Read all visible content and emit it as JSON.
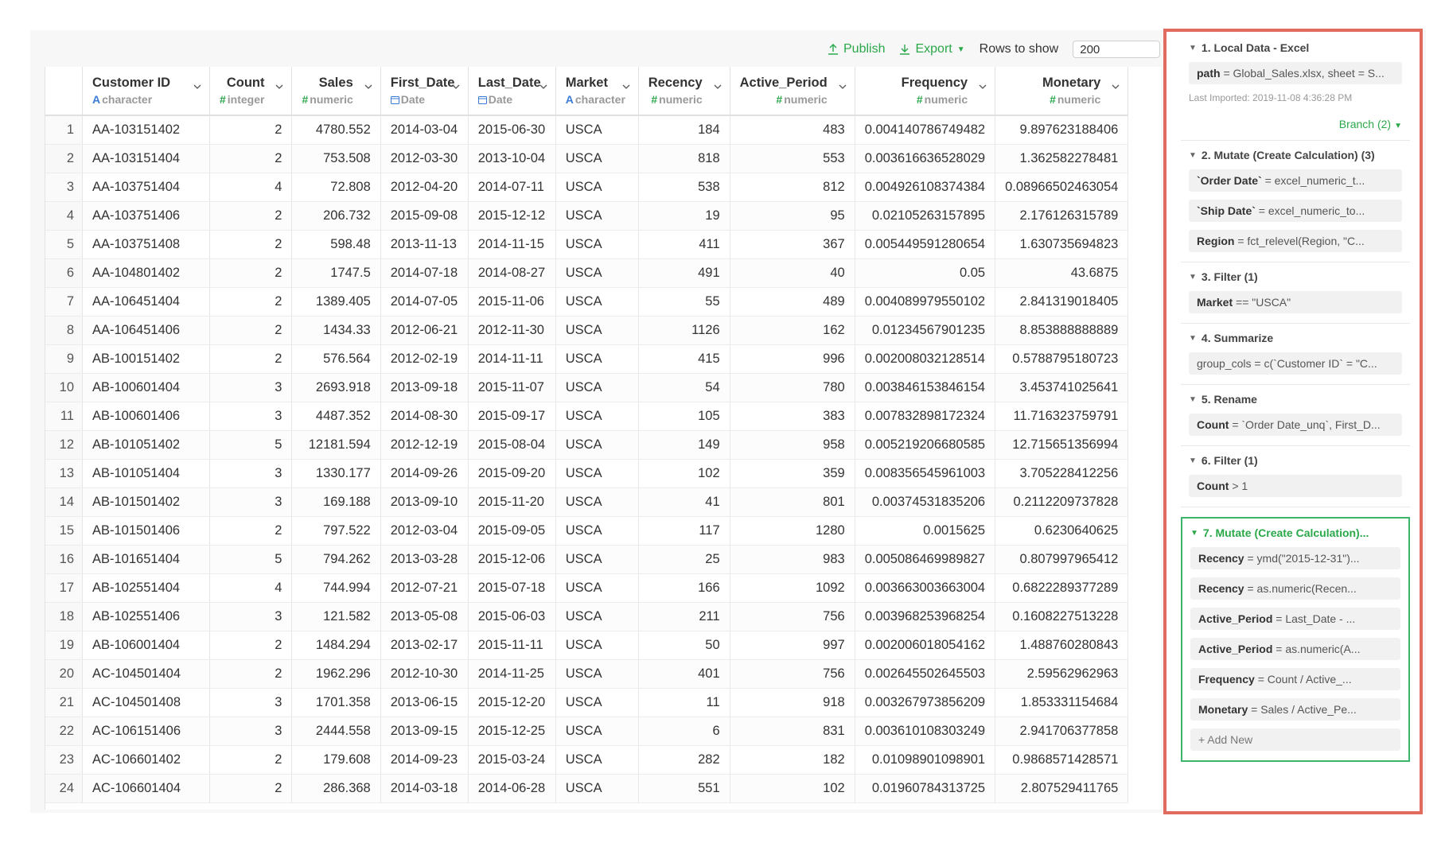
{
  "toolbar": {
    "publish_label": "Publish",
    "export_label": "Export",
    "rows_label": "Rows to show",
    "rows_value": "200"
  },
  "columns": [
    {
      "name": "",
      "type": "",
      "glyph": "",
      "align": "right"
    },
    {
      "name": "Customer ID",
      "type": "character",
      "glyph": "A",
      "align": "left"
    },
    {
      "name": "Count",
      "type": "integer",
      "glyph": "#",
      "align": "right"
    },
    {
      "name": "Sales",
      "type": "numeric",
      "glyph": "#",
      "align": "right"
    },
    {
      "name": "First_Date",
      "type": "Date",
      "glyph": "cal",
      "align": "left"
    },
    {
      "name": "Last_Date",
      "type": "Date",
      "glyph": "cal",
      "align": "left"
    },
    {
      "name": "Market",
      "type": "character",
      "glyph": "A",
      "align": "left"
    },
    {
      "name": "Recency",
      "type": "numeric",
      "glyph": "#",
      "align": "right"
    },
    {
      "name": "Active_Period",
      "type": "numeric",
      "glyph": "#",
      "align": "right"
    },
    {
      "name": "Frequency",
      "type": "numeric",
      "glyph": "#",
      "align": "right"
    },
    {
      "name": "Monetary",
      "type": "numeric",
      "glyph": "#",
      "align": "right"
    }
  ],
  "rows": [
    [
      "1",
      "AA-103151402",
      "2",
      "4780.552",
      "2014-03-04",
      "2015-06-30",
      "USCA",
      "184",
      "483",
      "0.004140786749482",
      "9.897623188406"
    ],
    [
      "2",
      "AA-103151404",
      "2",
      "753.508",
      "2012-03-30",
      "2013-10-04",
      "USCA",
      "818",
      "553",
      "0.003616636528029",
      "1.362582278481"
    ],
    [
      "3",
      "AA-103751404",
      "4",
      "72.808",
      "2012-04-20",
      "2014-07-11",
      "USCA",
      "538",
      "812",
      "0.004926108374384",
      "0.08966502463054"
    ],
    [
      "4",
      "AA-103751406",
      "2",
      "206.732",
      "2015-09-08",
      "2015-12-12",
      "USCA",
      "19",
      "95",
      "0.02105263157895",
      "2.176126315789"
    ],
    [
      "5",
      "AA-103751408",
      "2",
      "598.48",
      "2013-11-13",
      "2014-11-15",
      "USCA",
      "411",
      "367",
      "0.005449591280654",
      "1.630735694823"
    ],
    [
      "6",
      "AA-104801402",
      "2",
      "1747.5",
      "2014-07-18",
      "2014-08-27",
      "USCA",
      "491",
      "40",
      "0.05",
      "43.6875"
    ],
    [
      "7",
      "AA-106451404",
      "2",
      "1389.405",
      "2014-07-05",
      "2015-11-06",
      "USCA",
      "55",
      "489",
      "0.004089979550102",
      "2.841319018405"
    ],
    [
      "8",
      "AA-106451406",
      "2",
      "1434.33",
      "2012-06-21",
      "2012-11-30",
      "USCA",
      "1126",
      "162",
      "0.01234567901235",
      "8.853888888889"
    ],
    [
      "9",
      "AB-100151402",
      "2",
      "576.564",
      "2012-02-19",
      "2014-11-11",
      "USCA",
      "415",
      "996",
      "0.002008032128514",
      "0.5788795180723"
    ],
    [
      "10",
      "AB-100601404",
      "3",
      "2693.918",
      "2013-09-18",
      "2015-11-07",
      "USCA",
      "54",
      "780",
      "0.003846153846154",
      "3.453741025641"
    ],
    [
      "11",
      "AB-100601406",
      "3",
      "4487.352",
      "2014-08-30",
      "2015-09-17",
      "USCA",
      "105",
      "383",
      "0.007832898172324",
      "11.716323759791"
    ],
    [
      "12",
      "AB-101051402",
      "5",
      "12181.594",
      "2012-12-19",
      "2015-08-04",
      "USCA",
      "149",
      "958",
      "0.005219206680585",
      "12.715651356994"
    ],
    [
      "13",
      "AB-101051404",
      "3",
      "1330.177",
      "2014-09-26",
      "2015-09-20",
      "USCA",
      "102",
      "359",
      "0.008356545961003",
      "3.705228412256"
    ],
    [
      "14",
      "AB-101501402",
      "3",
      "169.188",
      "2013-09-10",
      "2015-11-20",
      "USCA",
      "41",
      "801",
      "0.00374531835206",
      "0.2112209737828"
    ],
    [
      "15",
      "AB-101501406",
      "2",
      "797.522",
      "2012-03-04",
      "2015-09-05",
      "USCA",
      "117",
      "1280",
      "0.0015625",
      "0.6230640625"
    ],
    [
      "16",
      "AB-101651404",
      "5",
      "794.262",
      "2013-03-28",
      "2015-12-06",
      "USCA",
      "25",
      "983",
      "0.005086469989827",
      "0.807997965412"
    ],
    [
      "17",
      "AB-102551404",
      "4",
      "744.994",
      "2012-07-21",
      "2015-07-18",
      "USCA",
      "166",
      "1092",
      "0.003663003663004",
      "0.6822289377289"
    ],
    [
      "18",
      "AB-102551406",
      "3",
      "121.582",
      "2013-05-08",
      "2015-06-03",
      "USCA",
      "211",
      "756",
      "0.003968253968254",
      "0.1608227513228"
    ],
    [
      "19",
      "AB-106001404",
      "2",
      "1484.294",
      "2013-02-17",
      "2015-11-11",
      "USCA",
      "50",
      "997",
      "0.002006018054162",
      "1.488760280843"
    ],
    [
      "20",
      "AC-104501404",
      "2",
      "1962.296",
      "2012-10-30",
      "2014-11-25",
      "USCA",
      "401",
      "756",
      "0.002645502645503",
      "2.59562962963"
    ],
    [
      "21",
      "AC-104501408",
      "3",
      "1701.358",
      "2013-06-15",
      "2015-12-20",
      "USCA",
      "11",
      "918",
      "0.003267973856209",
      "1.853331154684"
    ],
    [
      "22",
      "AC-106151406",
      "3",
      "2444.558",
      "2013-09-15",
      "2015-12-25",
      "USCA",
      "6",
      "831",
      "0.003610108303249",
      "2.941706377858"
    ],
    [
      "23",
      "AC-106601402",
      "2",
      "179.608",
      "2014-09-23",
      "2015-03-24",
      "USCA",
      "282",
      "182",
      "0.01098901098901",
      "0.9868571428571"
    ],
    [
      "24",
      "AC-106601404",
      "2",
      "286.368",
      "2014-03-18",
      "2014-06-28",
      "USCA",
      "551",
      "102",
      "0.01960784313725",
      "2.807529411765"
    ]
  ],
  "steps": [
    {
      "title": "1. Local Data - Excel",
      "active": false,
      "cmds": [
        {
          "bold": "path",
          "rest": " = Global_Sales.xlsx, sheet = S..."
        }
      ],
      "meta": "Last Imported: 2019-11-08 4:36:28 PM",
      "branch": "Branch (2)"
    },
    {
      "title": "2. Mutate (Create Calculation) (3)",
      "active": false,
      "cmds": [
        {
          "bold": "`Order Date`",
          "rest": " = excel_numeric_t..."
        },
        {
          "bold": "`Ship Date`",
          "rest": " = excel_numeric_to..."
        },
        {
          "bold": "Region",
          "rest": " = fct_relevel(Region, \"C..."
        }
      ]
    },
    {
      "title": "3. Filter (1)",
      "active": false,
      "cmds": [
        {
          "bold": "Market",
          "rest": " == \"USCA\""
        }
      ]
    },
    {
      "title": "4. Summarize",
      "active": false,
      "cmds": [
        {
          "bold": "",
          "rest": "group_cols = c(`Customer ID` = \"C..."
        }
      ]
    },
    {
      "title": "5. Rename",
      "active": false,
      "cmds": [
        {
          "bold": "Count",
          "rest": " = `Order Date_unq`, First_D..."
        }
      ]
    },
    {
      "title": "6. Filter (1)",
      "active": false,
      "cmds": [
        {
          "bold": "Count",
          "rest": " > 1"
        }
      ]
    },
    {
      "title": "7. Mutate (Create Calculation)...",
      "active": true,
      "cmds": [
        {
          "bold": "Recency",
          "rest": " = ymd(\"2015-12-31\")..."
        },
        {
          "bold": "Recency",
          "rest": " = as.numeric(Recen..."
        },
        {
          "bold": "Active_Period",
          "rest": " = Last_Date - ..."
        },
        {
          "bold": "Active_Period",
          "rest": " = as.numeric(A..."
        },
        {
          "bold": "Frequency",
          "rest": " = Count / Active_..."
        },
        {
          "bold": "Monetary",
          "rest": " = Sales / Active_Pe..."
        }
      ],
      "add_new": "+ Add New"
    }
  ],
  "colors": {
    "accent": "#2aa84a",
    "highlight_border": "#e06b5f",
    "active_step_border": "#3cb46a"
  }
}
